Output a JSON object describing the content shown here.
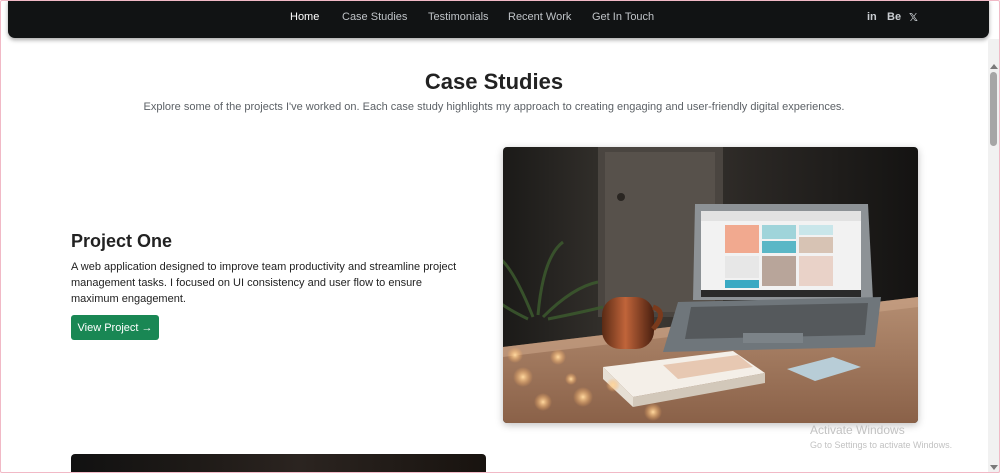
{
  "nav": {
    "links": [
      {
        "label": "Home",
        "active": true
      },
      {
        "label": "Case Studies",
        "active": false
      },
      {
        "label": "Testimonials",
        "active": false
      },
      {
        "label": "Recent Work",
        "active": false
      },
      {
        "label": "Get In Touch",
        "active": false
      }
    ],
    "social": [
      {
        "label": "in",
        "icon": "linkedin-icon"
      },
      {
        "label": "Be",
        "icon": "behance-icon"
      },
      {
        "label": "X",
        "icon": "x-twitter-icon"
      }
    ]
  },
  "section": {
    "title": "Case Studies",
    "subtitle": "Explore some of the projects I've worked on. Each case study highlights my approach to creating engaging and user-friendly digital experiences."
  },
  "projects": [
    {
      "title": "Project One",
      "description": "A web application designed to improve team productivity and streamline project management tasks. I focused on UI consistency and user flow to ensure maximum engagement.",
      "button_label": "View Project →",
      "image": "laptop-on-desk-photo"
    }
  ],
  "watermark": {
    "title": "Activate Windows",
    "subtitle": "Go to Settings to activate Windows."
  },
  "colors": {
    "nav_bg": "#111314",
    "button_bg": "#198754",
    "text": "#222222"
  }
}
